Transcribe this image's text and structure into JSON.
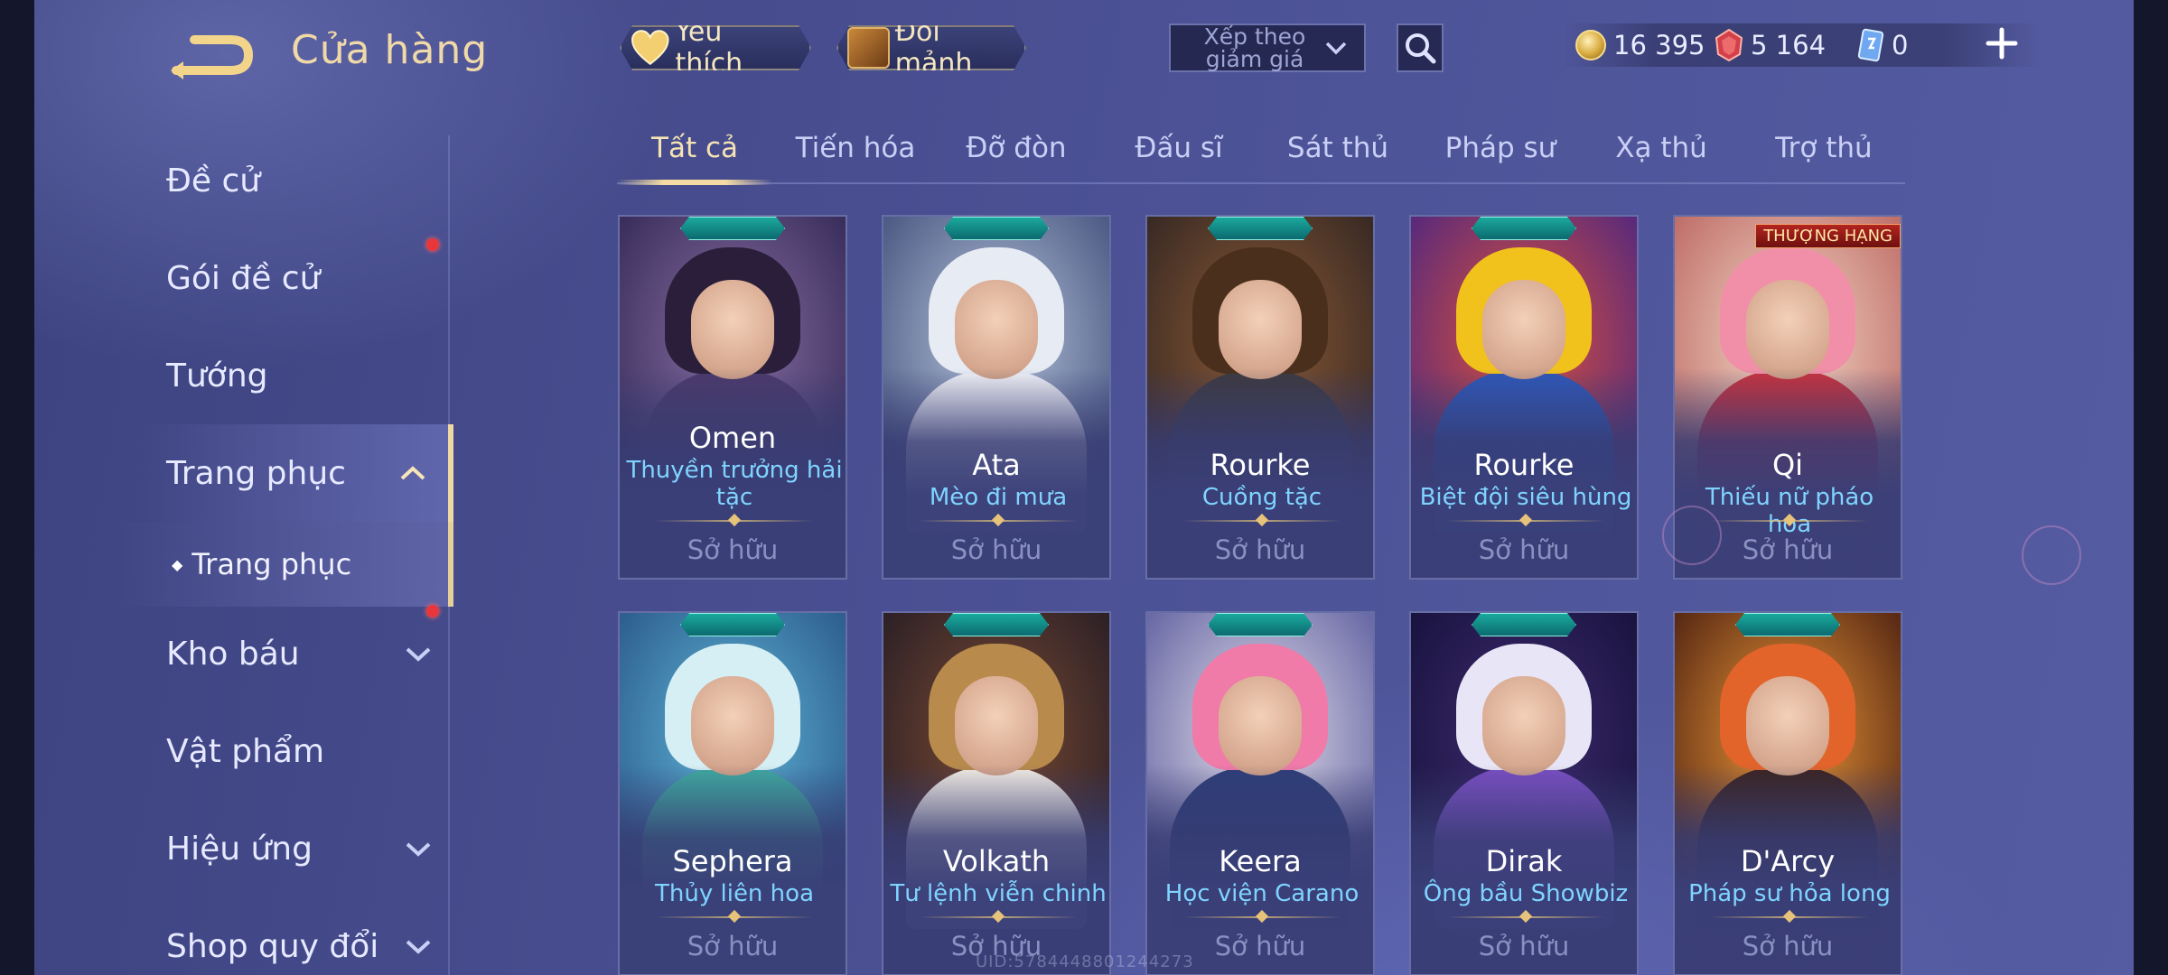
{
  "header": {
    "title": "Cửa hàng",
    "favorites_label": "Yêu thích",
    "shard_exchange_label": "Đổi mảnh",
    "sort": {
      "label": "Xếp theo giảm giá"
    },
    "currencies": {
      "gold": "16 395",
      "ruby": "5 164",
      "card": "0"
    },
    "colors": {
      "gold_text": "#f0d9a8",
      "sky_text": "#7fd4ff",
      "accent": "#f4dca4"
    }
  },
  "sidebar": {
    "items": [
      {
        "label": "Đề cử"
      },
      {
        "label": "Gói đề cử"
      },
      {
        "label": "Tướng"
      },
      {
        "label": "Trang phục"
      },
      {
        "label": "Kho báu"
      },
      {
        "label": "Vật phẩm"
      },
      {
        "label": "Hiệu ứng"
      },
      {
        "label": "Shop quy đổi"
      }
    ],
    "sub_item": "Trang phục"
  },
  "tabs": [
    "Tất cả",
    "Tiến hóa",
    "Đỡ đòn",
    "Đấu sĩ",
    "Sát thủ",
    "Pháp sư",
    "Xạ thủ",
    "Trợ thủ"
  ],
  "cards": [
    {
      "hero": "Omen",
      "skin": "Thuyền trưởng hải tặc",
      "status": "Sở hữu"
    },
    {
      "hero": "Ata",
      "skin": "Mèo đi mưa",
      "status": "Sở hữu"
    },
    {
      "hero": "Rourke",
      "skin": "Cuồng tặc",
      "status": "Sở hữu"
    },
    {
      "hero": "Rourke",
      "skin": "Biệt đội siêu hùng",
      "status": "Sở hữu"
    },
    {
      "hero": "Qi",
      "skin": "Thiếu nữ pháo hoa",
      "status": "Sở hữu",
      "badge": "THƯỢNG HẠNG"
    },
    {
      "hero": "Sephera",
      "skin": "Thủy liên hoa",
      "status": "Sở hữu"
    },
    {
      "hero": "Volkath",
      "skin": "Tư lệnh viễn chinh",
      "status": "Sở hữu"
    },
    {
      "hero": "Keera",
      "skin": "Học viện Carano",
      "status": "Sở hữu"
    },
    {
      "hero": "Dirak",
      "skin": "Ông bầu Showbiz",
      "status": "Sở hữu"
    },
    {
      "hero": "D'Arcy",
      "skin": "Pháp sư hỏa long",
      "status": "Sở hữu"
    }
  ],
  "watermark": "UID:5784448801244273"
}
